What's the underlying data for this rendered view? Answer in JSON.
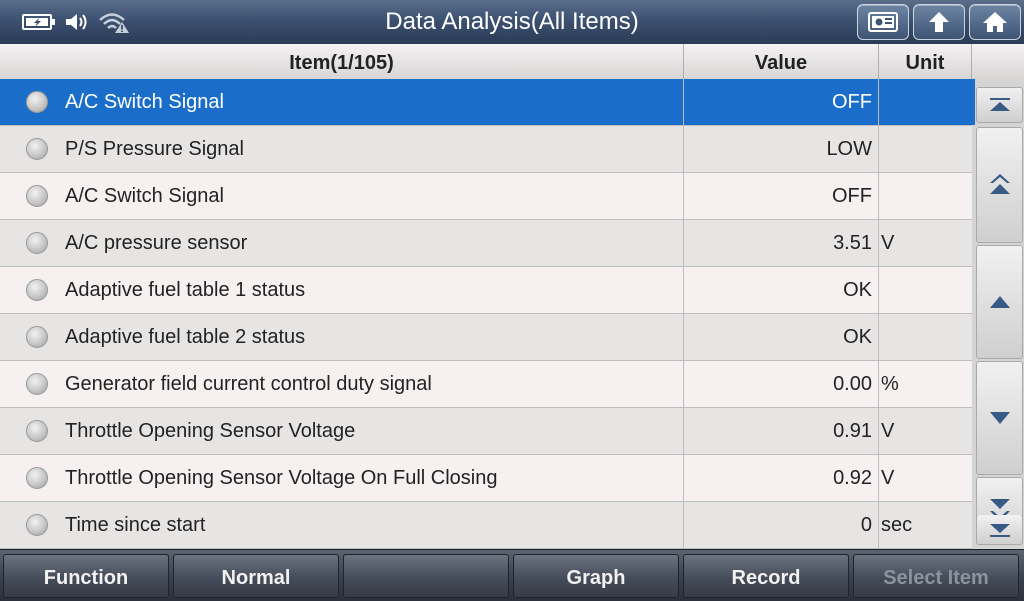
{
  "header": {
    "title": "Data Analysis(All Items)",
    "status_icons": [
      "battery-icon",
      "speaker-icon",
      "wifi-warning-icon"
    ],
    "buttons": [
      "screenshot-icon",
      "upload-icon",
      "home-icon"
    ]
  },
  "table": {
    "columns": {
      "item": "Item(1/105)",
      "value": "Value",
      "unit": "Unit"
    },
    "rows": [
      {
        "item": "A/C Switch Signal",
        "value": "OFF",
        "unit": ""
      },
      {
        "item": "P/S Pressure Signal",
        "value": "LOW",
        "unit": ""
      },
      {
        "item": "A/C Switch Signal",
        "value": "OFF",
        "unit": ""
      },
      {
        "item": "A/C pressure sensor",
        "value": "3.51",
        "unit": "V"
      },
      {
        "item": "Adaptive fuel table 1 status",
        "value": "OK",
        "unit": ""
      },
      {
        "item": "Adaptive fuel table 2 status",
        "value": "OK",
        "unit": ""
      },
      {
        "item": "Generator field current control duty signal",
        "value": "0.00",
        "unit": "%"
      },
      {
        "item": "Throttle Opening Sensor Voltage",
        "value": "0.91",
        "unit": "V"
      },
      {
        "item": "Throttle Opening Sensor Voltage On Full Closing",
        "value": "0.92",
        "unit": "V"
      },
      {
        "item": "Time since start",
        "value": "0",
        "unit": "sec"
      }
    ],
    "selected_index": 0
  },
  "scroll_buttons": [
    "scroll-top-icon",
    "page-up-icon",
    "scroll-up-icon",
    "scroll-down-icon",
    "page-down-icon",
    "scroll-bottom-icon"
  ],
  "footer": {
    "function": "Function",
    "normal": "Normal",
    "blank": "",
    "graph": "Graph",
    "record": "Record",
    "select_item": "Select Item"
  },
  "colors": {
    "selected_row": "#1a6ec9",
    "accent": "#3d5170"
  }
}
